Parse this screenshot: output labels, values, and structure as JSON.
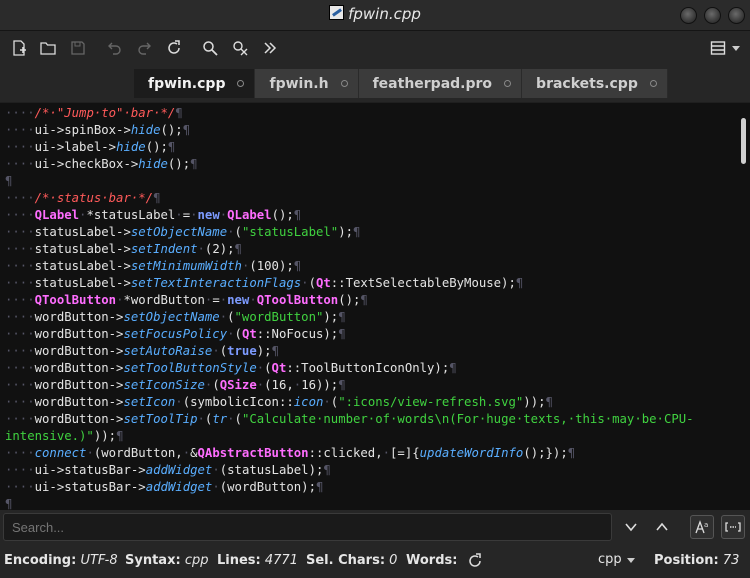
{
  "window": {
    "title": "fpwin.cpp",
    "icon": "featherpad-icon"
  },
  "toolbar": {
    "buttons": [
      "new-document-icon",
      "open-folder-icon",
      "save-icon",
      "undo-icon",
      "redo-icon",
      "reload-icon",
      "find-icon",
      "find-replace-icon",
      "go-to-line-icon"
    ],
    "menu": "hamburger-menu-icon"
  },
  "tabs": [
    {
      "label": "fpwin.cpp",
      "active": true
    },
    {
      "label": "fpwin.h",
      "active": false
    },
    {
      "label": "featherpad.pro",
      "active": false
    },
    {
      "label": "brackets.cpp",
      "active": false
    }
  ],
  "code_lines": [
    [
      [
        "ws",
        "····"
      ],
      [
        "cm",
        "/*·\"Jump·to\"·bar·*/"
      ],
      [
        "ws",
        "¶"
      ]
    ],
    [
      [
        "ws",
        "····"
      ],
      [
        "t",
        "ui->spinBox->"
      ],
      [
        "fn",
        "hide"
      ],
      [
        "t",
        "();"
      ],
      [
        "ws",
        "¶"
      ]
    ],
    [
      [
        "ws",
        "····"
      ],
      [
        "t",
        "ui->label->"
      ],
      [
        "fn",
        "hide"
      ],
      [
        "t",
        "();"
      ],
      [
        "ws",
        "¶"
      ]
    ],
    [
      [
        "ws",
        "····"
      ],
      [
        "t",
        "ui->checkBox->"
      ],
      [
        "fn",
        "hide"
      ],
      [
        "t",
        "();"
      ],
      [
        "ws",
        "¶"
      ]
    ],
    [
      [
        "ws",
        "¶"
      ]
    ],
    [
      [
        "ws",
        "····"
      ],
      [
        "cm",
        "/*·status·bar·*/"
      ],
      [
        "ws",
        "¶"
      ]
    ],
    [
      [
        "ws",
        "····"
      ],
      [
        "ty",
        "QLabel"
      ],
      [
        "ws",
        "·"
      ],
      [
        "t",
        "*statusLabel"
      ],
      [
        "ws",
        "·"
      ],
      [
        "t",
        "="
      ],
      [
        "ws",
        "·"
      ],
      [
        "kw",
        "new"
      ],
      [
        "ws",
        "·"
      ],
      [
        "ty",
        "QLabel"
      ],
      [
        "t",
        "();"
      ],
      [
        "ws",
        "¶"
      ]
    ],
    [
      [
        "ws",
        "····"
      ],
      [
        "t",
        "statusLabel->"
      ],
      [
        "fn",
        "setObjectName"
      ],
      [
        "ws",
        "·"
      ],
      [
        "t",
        "("
      ],
      [
        "st",
        "\"statusLabel\""
      ],
      [
        "t",
        ");"
      ],
      [
        "ws",
        "¶"
      ]
    ],
    [
      [
        "ws",
        "····"
      ],
      [
        "t",
        "statusLabel->"
      ],
      [
        "fn",
        "setIndent"
      ],
      [
        "ws",
        "·"
      ],
      [
        "t",
        "(2);"
      ],
      [
        "ws",
        "¶"
      ]
    ],
    [
      [
        "ws",
        "····"
      ],
      [
        "t",
        "statusLabel->"
      ],
      [
        "fn",
        "setMinimumWidth"
      ],
      [
        "ws",
        "·"
      ],
      [
        "t",
        "(100);"
      ],
      [
        "ws",
        "¶"
      ]
    ],
    [
      [
        "ws",
        "····"
      ],
      [
        "t",
        "statusLabel->"
      ],
      [
        "fn",
        "setTextInteractionFlags"
      ],
      [
        "ws",
        "·"
      ],
      [
        "t",
        "("
      ],
      [
        "ty",
        "Qt"
      ],
      [
        "t",
        "::TextSelectableByMouse);"
      ],
      [
        "ws",
        "¶"
      ]
    ],
    [
      [
        "ws",
        "····"
      ],
      [
        "ty",
        "QToolButton"
      ],
      [
        "ws",
        "·"
      ],
      [
        "t",
        "*wordButton"
      ],
      [
        "ws",
        "·"
      ],
      [
        "t",
        "="
      ],
      [
        "ws",
        "·"
      ],
      [
        "kw",
        "new"
      ],
      [
        "ws",
        "·"
      ],
      [
        "ty",
        "QToolButton"
      ],
      [
        "t",
        "();"
      ],
      [
        "ws",
        "¶"
      ]
    ],
    [
      [
        "ws",
        "····"
      ],
      [
        "t",
        "wordButton->"
      ],
      [
        "fn",
        "setObjectName"
      ],
      [
        "ws",
        "·"
      ],
      [
        "t",
        "("
      ],
      [
        "st",
        "\"wordButton\""
      ],
      [
        "t",
        ");"
      ],
      [
        "ws",
        "¶"
      ]
    ],
    [
      [
        "ws",
        "····"
      ],
      [
        "t",
        "wordButton->"
      ],
      [
        "fn",
        "setFocusPolicy"
      ],
      [
        "ws",
        "·"
      ],
      [
        "t",
        "("
      ],
      [
        "ty",
        "Qt"
      ],
      [
        "t",
        "::NoFocus);"
      ],
      [
        "ws",
        "¶"
      ]
    ],
    [
      [
        "ws",
        "····"
      ],
      [
        "t",
        "wordButton->"
      ],
      [
        "fn",
        "setAutoRaise"
      ],
      [
        "ws",
        "·"
      ],
      [
        "t",
        "("
      ],
      [
        "kw",
        "true"
      ],
      [
        "t",
        ");"
      ],
      [
        "ws",
        "¶"
      ]
    ],
    [
      [
        "ws",
        "····"
      ],
      [
        "t",
        "wordButton->"
      ],
      [
        "fn",
        "setToolButtonStyle"
      ],
      [
        "ws",
        "·"
      ],
      [
        "t",
        "("
      ],
      [
        "ty",
        "Qt"
      ],
      [
        "t",
        "::ToolButtonIconOnly);"
      ],
      [
        "ws",
        "¶"
      ]
    ],
    [
      [
        "ws",
        "····"
      ],
      [
        "t",
        "wordButton->"
      ],
      [
        "fn",
        "setIconSize"
      ],
      [
        "ws",
        "·"
      ],
      [
        "t",
        "("
      ],
      [
        "ty",
        "QSize"
      ],
      [
        "ws",
        "·"
      ],
      [
        "t",
        "(16,"
      ],
      [
        "ws",
        "·"
      ],
      [
        "t",
        "16));"
      ],
      [
        "ws",
        "¶"
      ]
    ],
    [
      [
        "ws",
        "····"
      ],
      [
        "t",
        "wordButton->"
      ],
      [
        "fn",
        "setIcon"
      ],
      [
        "ws",
        "·"
      ],
      [
        "t",
        "(symbolicIcon::"
      ],
      [
        "fn",
        "icon"
      ],
      [
        "ws",
        "·"
      ],
      [
        "t",
        "("
      ],
      [
        "st",
        "\":icons/view-refresh.svg\""
      ],
      [
        "t",
        "));"
      ],
      [
        "ws",
        "¶"
      ]
    ],
    [
      [
        "ws",
        "····"
      ],
      [
        "t",
        "wordButton->"
      ],
      [
        "fn",
        "setToolTip"
      ],
      [
        "ws",
        "·"
      ],
      [
        "t",
        "("
      ],
      [
        "fn",
        "tr"
      ],
      [
        "ws",
        "·"
      ],
      [
        "t",
        "("
      ],
      [
        "st",
        "\"Calculate·number·of·words\\n(For·huge·texts,·this·may·be·CPU-"
      ]
    ],
    [
      [
        "st",
        "intensive.)\""
      ],
      [
        "t",
        "));"
      ],
      [
        "ws",
        "¶"
      ]
    ],
    [
      [
        "ws",
        "····"
      ],
      [
        "fn",
        "connect"
      ],
      [
        "ws",
        "·"
      ],
      [
        "t",
        "(wordButton,"
      ],
      [
        "ws",
        "·"
      ],
      [
        "t",
        "&"
      ],
      [
        "ty",
        "QAbstractButton"
      ],
      [
        "t",
        "::clicked,"
      ],
      [
        "ws",
        "·"
      ],
      [
        "t",
        "[=]{"
      ],
      [
        "fn",
        "updateWordInfo"
      ],
      [
        "t",
        "();});"
      ],
      [
        "ws",
        "¶"
      ]
    ],
    [
      [
        "ws",
        "····"
      ],
      [
        "t",
        "ui->statusBar->"
      ],
      [
        "fn",
        "addWidget"
      ],
      [
        "ws",
        "·"
      ],
      [
        "t",
        "(statusLabel);"
      ],
      [
        "ws",
        "¶"
      ]
    ],
    [
      [
        "ws",
        "····"
      ],
      [
        "t",
        "ui->statusBar->"
      ],
      [
        "fn",
        "addWidget"
      ],
      [
        "ws",
        "·"
      ],
      [
        "t",
        "(wordButton);"
      ],
      [
        "ws",
        "¶"
      ]
    ],
    [
      [
        "ws",
        "¶"
      ]
    ]
  ],
  "search": {
    "placeholder": "Search..."
  },
  "status": {
    "encoding_label": "Encoding:",
    "encoding_value": "UTF-8",
    "syntax_label": "Syntax:",
    "syntax_value": "cpp",
    "lines_label": "Lines:",
    "lines_value": "4771",
    "selchars_label": "Sel. Chars:",
    "selchars_value": "0",
    "words_label": "Words:",
    "language": "cpp",
    "position_label": "Position:",
    "position_value": "73"
  },
  "colors": {
    "comment": "#ff5a5a",
    "function": "#5aaeff",
    "string": "#40d240",
    "qt_type": "#ff6dff",
    "keyword": "#7d9bff",
    "background": "#111111"
  }
}
